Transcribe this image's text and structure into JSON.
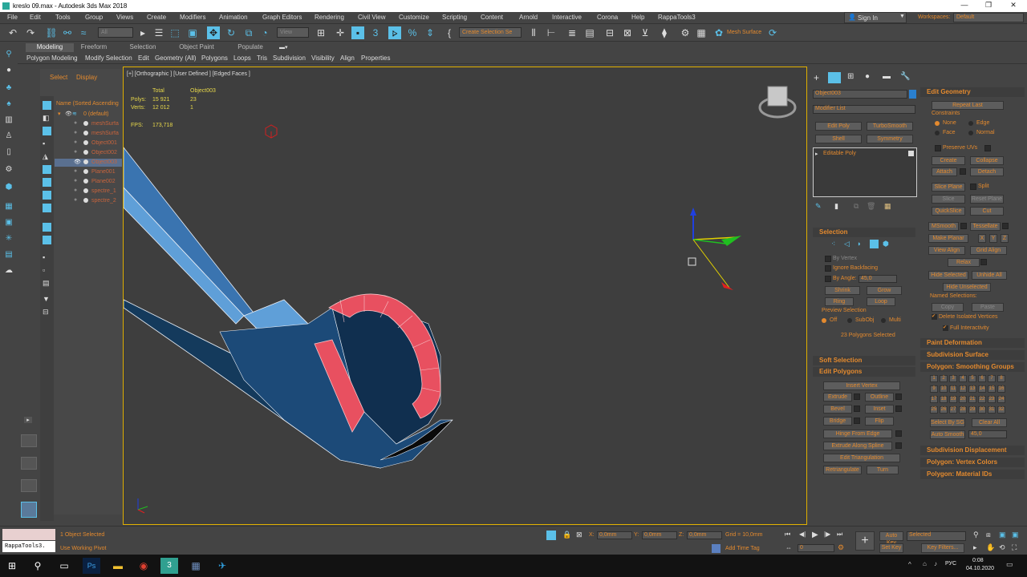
{
  "title": "kreslo 09.max - Autodesk 3ds Max 2018",
  "menu": [
    "File",
    "Edit",
    "Tools",
    "Group",
    "Views",
    "Create",
    "Modifiers",
    "Animation",
    "Graph Editors",
    "Rendering",
    "Civil View",
    "Customize",
    "Scripting",
    "Content",
    "Arnold",
    "Interactive",
    "Corona",
    "Help",
    "RappaTools3"
  ],
  "account": {
    "sign_in": "Sign In",
    "workspaces_label": "Workspaces:",
    "workspace": "Default"
  },
  "toolbar": {
    "filter": "All",
    "view": "View",
    "selset": "Create Selection Se",
    "mesh_surface": "Mesh Surface"
  },
  "ribbon": {
    "tabs": [
      "Modeling",
      "Freeform",
      "Selection",
      "Object Paint",
      "Populate"
    ],
    "subtabs": [
      "Polygon Modeling",
      "Modify Selection",
      "Edit",
      "Geometry (All)",
      "Polygons",
      "Loops",
      "Tris",
      "Subdivision",
      "Visibility",
      "Align",
      "Properties"
    ]
  },
  "scene": {
    "tabs": [
      "Select",
      "Display"
    ],
    "header": "Name (Sorted Ascending",
    "items": [
      "0 (default)",
      "meshSurfa",
      "meshSurfa",
      "Object001",
      "Object002",
      "Object003",
      "Plane001",
      "Plane002",
      "spectre_1",
      "spectre_2"
    ]
  },
  "viewport": {
    "label": "[+] [Orthographic ] [User Defined ] [Edged Faces ]",
    "stats_total": "Total",
    "stats_obj": "Object003",
    "polys_label": "Polys:",
    "polys_total": "15 921",
    "polys_obj": "23",
    "verts_label": "Verts:",
    "verts_total": "12 012",
    "verts_obj": "1",
    "fps_label": "FPS:",
    "fps": "173,718"
  },
  "cmd": {
    "object_name": "Object003",
    "modifier_list": "Modifier List",
    "edit_poly": "Edit Poly",
    "turbosmooth": "TurboSmooth",
    "shell": "Shell",
    "symmetry": "Symmetry",
    "stack_item": "Editable Poly"
  },
  "selection": {
    "head": "Selection",
    "by_vertex": "By Vertex",
    "ignore_backfacing": "Ignore Backfacing",
    "by_angle": "By Angle:",
    "angle": "45,0",
    "shrink": "Shrink",
    "grow": "Grow",
    "ring": "Ring",
    "loop": "Loop",
    "preview_label": "Preview Selection",
    "off": "Off",
    "subobj": "SubObj",
    "multi": "Multi",
    "count": "23 Polygons Selected"
  },
  "soft_selection": "Soft Selection",
  "edit_polygons": {
    "head": "Edit Polygons",
    "insert_vertex": "Insert Vertex",
    "extrude": "Extrude",
    "outline": "Outline",
    "bevel": "Bevel",
    "inset": "Inset",
    "bridge": "Bridge",
    "flip": "Flip",
    "hinge": "Hinge From Edge",
    "extrude_spline": "Extrude Along Spline",
    "edit_tri": "Edit Triangulation",
    "retriangulate": "Retriangulate",
    "turn": "Turn"
  },
  "edit_geometry": {
    "head": "Edit Geometry",
    "repeat_last": "Repeat Last",
    "constraints": "Constraints",
    "none": "None",
    "edge": "Edge",
    "face": "Face",
    "normal": "Normal",
    "preserve_uvs": "Preserve UVs",
    "create": "Create",
    "collapse": "Collapse",
    "attach": "Attach",
    "detach": "Detach",
    "slice_plane": "Slice Plane",
    "split": "Split",
    "slice": "Slice",
    "reset_plane": "Reset Plane",
    "quickslice": "QuickSlice",
    "cut": "Cut",
    "msmooth": "MSmooth",
    "tessellate": "Tessellate",
    "make_planar": "Make Planar",
    "x": "X",
    "y": "Y",
    "z": "Z",
    "view_align": "View Align",
    "grid_align": "Grid Align",
    "relax": "Relax",
    "hide_selected": "Hide Selected",
    "unhide_all": "Unhide All",
    "hide_unselected": "Hide Unselected",
    "named_sel": "Named Selections:",
    "copy": "Copy",
    "paste": "Paste",
    "delete_isolated": "Delete Isolated Vertices",
    "full_interactivity": "Full Interactivity"
  },
  "rollouts2": {
    "paint_deformation": "Paint Deformation",
    "subdivision_surface": "Subdivision Surface",
    "smoothing_groups": "Polygon: Smoothing Groups",
    "select_by_sg": "Select By SG",
    "clear_all": "Clear All",
    "auto_smooth": "Auto Smooth",
    "auto_smooth_val": "45,0",
    "subdivision_displacement": "Subdivision Displacement",
    "vertex_colors": "Polygon: Vertex Colors",
    "material_ids": "Polygon: Material IDs"
  },
  "sg_numbers": [
    "1",
    "2",
    "3",
    "4",
    "5",
    "6",
    "7",
    "8",
    "9",
    "10",
    "11",
    "12",
    "13",
    "14",
    "15",
    "16",
    "17",
    "18",
    "19",
    "20",
    "21",
    "22",
    "23",
    "24",
    "25",
    "26",
    "27",
    "28",
    "29",
    "30",
    "31",
    "32"
  ],
  "status": {
    "script": "RappaTools3.",
    "selected": "1 Object Selected",
    "hint": "Use Working Pivot",
    "x_label": "X:",
    "x": "0,0mm",
    "y_label": "Y:",
    "y": "0,0mm",
    "z_label": "Z:",
    "z": "0,0mm",
    "grid": "Grid = 10,0mm",
    "add_time_tag": "Add Time Tag",
    "frame": "0",
    "auto_key": "Auto Key",
    "key_mode": "Selected",
    "set_key": "Set Key",
    "key_filters": "Key Filters..."
  },
  "clock": {
    "time": "0:08",
    "date": "04.10.2020",
    "lang": "РУС"
  },
  "colors": {
    "accent": "#e48a2e",
    "selected_face": "#e85060",
    "mesh_blue": "#2a5f8f",
    "viewport_border": "#e0b000"
  }
}
